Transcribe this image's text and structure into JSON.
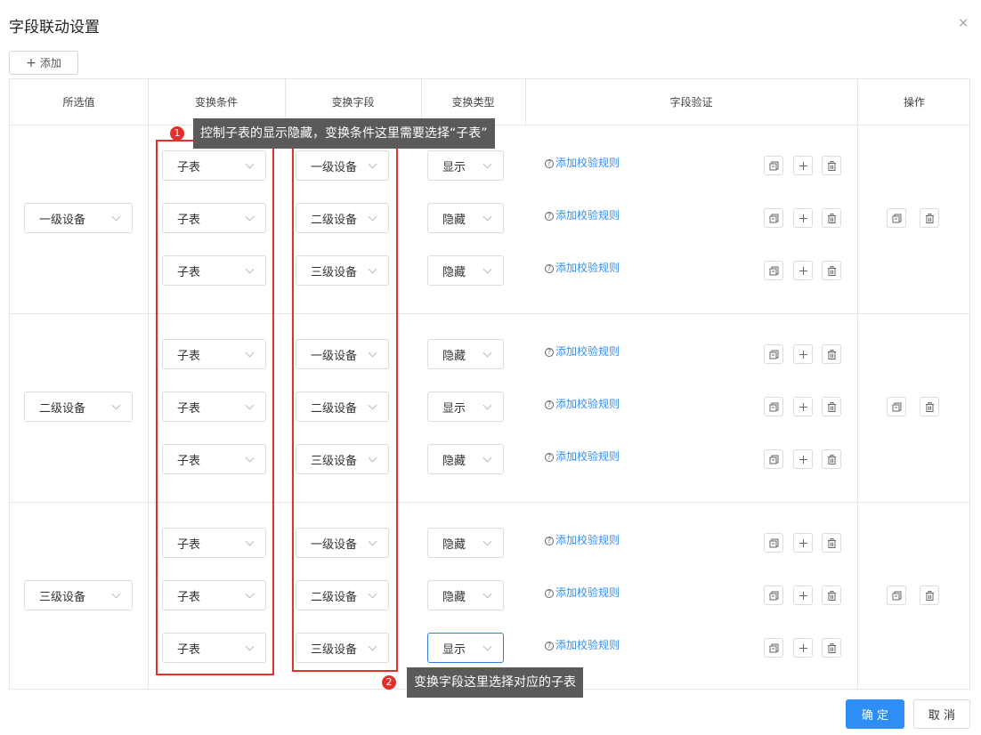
{
  "dialog": {
    "title": "字段联动设置",
    "close": "×",
    "add_label": "添加",
    "add_icon": "plus-icon"
  },
  "columns": [
    "所选值",
    "变换条件",
    "变换字段",
    "变换类型",
    "字段验证",
    "操作"
  ],
  "groups": [
    {
      "selected_value": "一级设备",
      "rows": [
        {
          "condition": "子表",
          "field": "一级设备",
          "type": "显示",
          "rule": "添加校验规则"
        },
        {
          "condition": "子表",
          "field": "二级设备",
          "type": "隐藏",
          "rule": "添加校验规则"
        },
        {
          "condition": "子表",
          "field": "三级设备",
          "type": "隐藏",
          "rule": "添加校验规则"
        }
      ]
    },
    {
      "selected_value": "二级设备",
      "rows": [
        {
          "condition": "子表",
          "field": "一级设备",
          "type": "隐藏",
          "rule": "添加校验规则"
        },
        {
          "condition": "子表",
          "field": "二级设备",
          "type": "显示",
          "rule": "添加校验规则"
        },
        {
          "condition": "子表",
          "field": "三级设备",
          "type": "隐藏",
          "rule": "添加校验规则"
        }
      ]
    },
    {
      "selected_value": "三级设备",
      "rows": [
        {
          "condition": "子表",
          "field": "一级设备",
          "type": "隐藏",
          "rule": "添加校验规则"
        },
        {
          "condition": "子表",
          "field": "二级设备",
          "type": "隐藏",
          "rule": "添加校验规则"
        },
        {
          "condition": "子表",
          "field": "三级设备",
          "type": "显示",
          "rule": "添加校验规则"
        }
      ]
    }
  ],
  "annotations": [
    {
      "number": "1",
      "text": "控制子表的显示隐藏，变换条件这里需要选择“子表”"
    },
    {
      "number": "2",
      "text": "变换字段这里选择对应的子表"
    }
  ],
  "footer": {
    "confirm_label": "确 定",
    "cancel_label": "取 消"
  },
  "colors": {
    "primary": "#2f8ef5",
    "link": "#3a8ee6",
    "annotation_box": "#e0312b",
    "callout_bg": "#5a5a5a"
  }
}
